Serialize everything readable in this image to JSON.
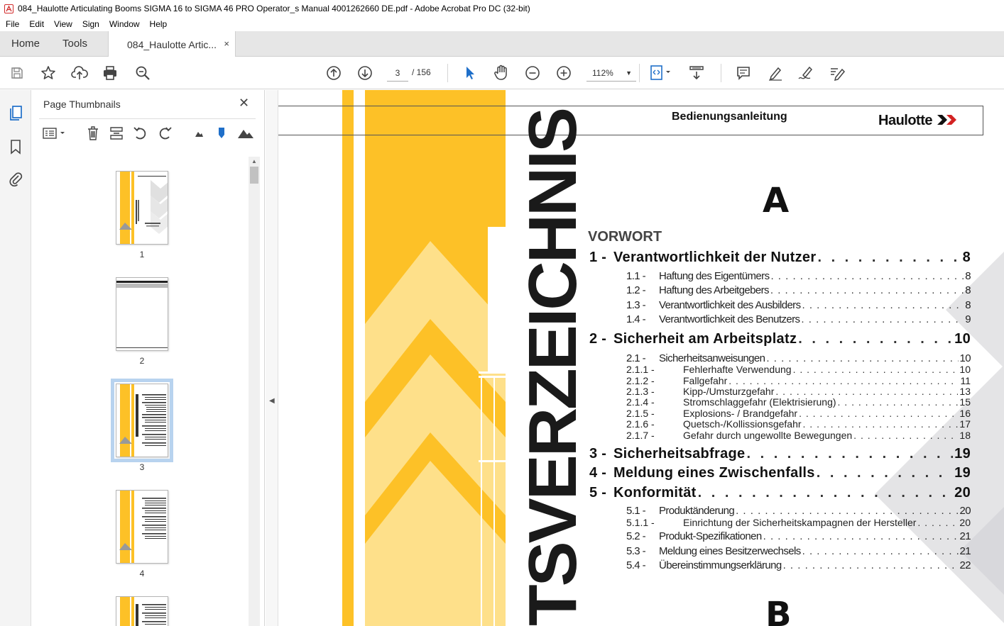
{
  "window": {
    "title": "084_Haulotte Articulating Booms SIGMA 16 to SIGMA 46 PRO Operator_s Manual 4001262660 DE.pdf - Adobe Acrobat Pro DC (32-bit)"
  },
  "menu": [
    "File",
    "Edit",
    "View",
    "Sign",
    "Window",
    "Help"
  ],
  "tabs": {
    "home": "Home",
    "tools": "Tools",
    "document": "084_Haulotte Artic...",
    "close": "×"
  },
  "toolbar": {
    "current_page": "3",
    "total_pages": "/  156",
    "zoom": "112%",
    "zoom_caret": "▼"
  },
  "panel": {
    "title": "Page Thumbnails",
    "close": "✕",
    "thumbnails": [
      {
        "label": "1"
      },
      {
        "label": "2"
      },
      {
        "label": "3"
      },
      {
        "label": "4"
      }
    ]
  },
  "document": {
    "header_title": "Bedienungsanleitung",
    "brand": "Haulotte",
    "vertical_word": "TSVERZEICHNIS",
    "section_letter_a": "A",
    "section_letter_b": "B",
    "toc_head": "VORWORT",
    "toc": [
      {
        "num": "1 - ",
        "title": "Verantwortlichkeit der Nutzer ",
        "page": "8",
        "level": 1
      },
      {
        "num": "1.1 -",
        "title": "Haftung des Eigentümers",
        "page": "8",
        "level": 2
      },
      {
        "num": "1.2 -",
        "title": "Haftung des Arbeitgebers",
        "page": "8",
        "level": 2
      },
      {
        "num": "1.3 -",
        "title": "Verantwortlichkeit des Ausbilders",
        "page": "8",
        "level": 2
      },
      {
        "num": "1.4 -",
        "title": "Verantwortlichkeit des Benutzers",
        "page": "9",
        "level": 2
      },
      {
        "num": "2 - ",
        "title": "Sicherheit am Arbeitsplatz ",
        "page": "10",
        "level": 1
      },
      {
        "num": "2.1 -",
        "title": "Sicherheitsanweisungen",
        "page": "10",
        "level": 2
      },
      {
        "num": "2.1.1 -",
        "title": "Fehlerhafte Verwendung",
        "page": "10",
        "level": 3
      },
      {
        "num": "2.1.2 -",
        "title": "Fallgefahr",
        "page": "11",
        "level": 3
      },
      {
        "num": "2.1.3 -",
        "title": "Kipp-/Umsturzgefahr",
        "page": "13",
        "level": 3
      },
      {
        "num": "2.1.4 -",
        "title": "Stromschlaggefahr (Elektrisierung)",
        "page": "15",
        "level": 3
      },
      {
        "num": "2.1.5 -",
        "title": "Explosions- / Brandgefahr",
        "page": "16",
        "level": 3
      },
      {
        "num": "2.1.6 -",
        "title": "Quetsch-/Kollissionsgefahr",
        "page": "17",
        "level": 3
      },
      {
        "num": "2.1.7 -",
        "title": "Gefahr durch ungewollte Bewegungen",
        "page": "18",
        "level": 3
      },
      {
        "num": "3 - ",
        "title": "Sicherheitsabfrage ",
        "page": "19",
        "level": 1
      },
      {
        "num": "4 - ",
        "title": "Meldung eines Zwischenfalls ",
        "page": "19",
        "level": 1
      },
      {
        "num": "5 - ",
        "title": "Konformität ",
        "page": "20",
        "level": 1
      },
      {
        "num": "5.1 -",
        "title": "Produktänderung",
        "page": "20",
        "level": 2
      },
      {
        "num": "5.1.1 -",
        "title": "Einrichtung der Sicherheitskampagnen der Hersteller",
        "page": "20",
        "level": 3
      },
      {
        "num": "5.2 -",
        "title": "Produkt-Spezifikationen",
        "page": "21",
        "level": 2
      },
      {
        "num": "5.3 -",
        "title": "Meldung eines Besitzerwechsels",
        "page": "21",
        "level": 2
      },
      {
        "num": "5.4 -",
        "title": "Übereinstimmungserklärung",
        "page": "22",
        "level": 2
      }
    ]
  }
}
